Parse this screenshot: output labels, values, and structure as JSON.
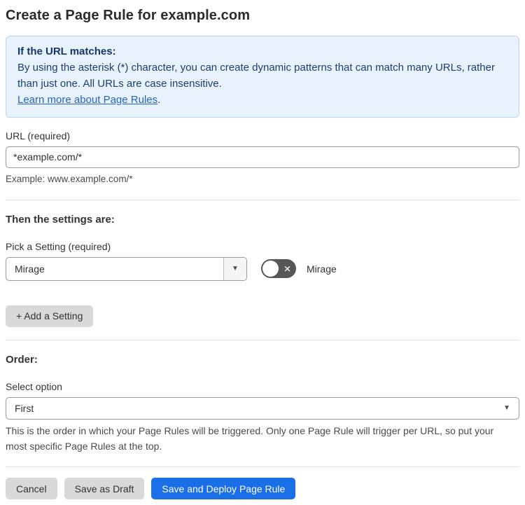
{
  "page": {
    "title": "Create a Page Rule for example.com"
  },
  "info_box": {
    "heading": "If the URL matches:",
    "body": "By using the asterisk (*) character, you can create dynamic patterns that can match many URLs, rather than just one. All URLs are case insensitive.",
    "link": "Learn more about Page Rules",
    "link_suffix": "."
  },
  "url_field": {
    "label": "URL (required)",
    "value": "*example.com/*",
    "helper": "Example: www.example.com/*"
  },
  "settings": {
    "heading": "Then the settings are:",
    "picker_label": "Pick a Setting (required)",
    "picker_value": "Mirage",
    "toggle_label": "Mirage",
    "toggle_state": "off",
    "toggle_off_glyph": "✕",
    "add_button": "+ Add a Setting"
  },
  "order": {
    "heading": "Order:",
    "select_label": "Select option",
    "select_value": "First",
    "helper": "This is the order in which your Page Rules will be triggered. Only one Page Rule will trigger per URL, so put your most specific Page Rules at the top."
  },
  "actions": {
    "cancel": "Cancel",
    "save_draft": "Save as Draft",
    "save_deploy": "Save and Deploy Page Rule"
  },
  "icons": {
    "chevron_down": "▼"
  },
  "colors": {
    "accent_blue": "#1a6fe8",
    "link_blue": "#2563c9",
    "info_background": "#e8f2fc",
    "info_border": "#bcd8f2",
    "info_text": "#1e3c6e",
    "gray_button": "#d9d9d9",
    "toggle_track": "#575757"
  }
}
